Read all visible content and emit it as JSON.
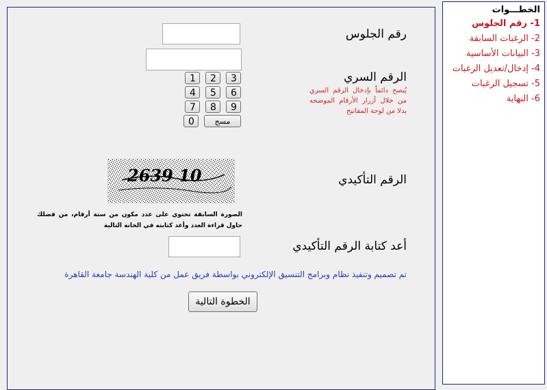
{
  "sidebar": {
    "title": "الخطـــوات",
    "items": [
      {
        "label": "1- رقم الجلوس",
        "active": true
      },
      {
        "label": "2- الرغبات السابقة"
      },
      {
        "label": "3- البيانات الأساسية"
      },
      {
        "label": "4- إدخال/تعديل الرغبات"
      },
      {
        "label": "5- تسجيل الرغبات"
      },
      {
        "label": "6- النهاية"
      }
    ]
  },
  "form": {
    "seat_number_label": "رقم الجلوس",
    "seat_number_value": "",
    "password_label": "الرقم السري",
    "password_value": "",
    "password_hint": "يُنصح دائماً بإدخال الرقم السري من خلال أزرار الأرقام الموضحه بدلا من لوحة المفاتيح",
    "keypad": {
      "row1": [
        "1",
        "2",
        "3"
      ],
      "row2": [
        "4",
        "5",
        "6"
      ],
      "row3": [
        "7",
        "8",
        "9"
      ],
      "zero": "0",
      "clear": "مسح"
    },
    "confirm_code_label": "الرقم التأكيدي",
    "captcha_text": "2639 10",
    "captcha_caption": "الصورة السابقة تحتوي على عدد مكون من ستة أرقام، من فضلك حاول قراءة العدد وأعد كتابته في الخانة التالية",
    "retype_label": "أعد كتابة الرقم التأكيدي",
    "retype_value": "",
    "credit": "تم تصميم وتنفيذ نظام وبرامج التنسيق الإلكتروني بواسطة فريق عمل من كلية الهندسة جامعة القاهرة",
    "next_button": "الخطوة التالية"
  }
}
